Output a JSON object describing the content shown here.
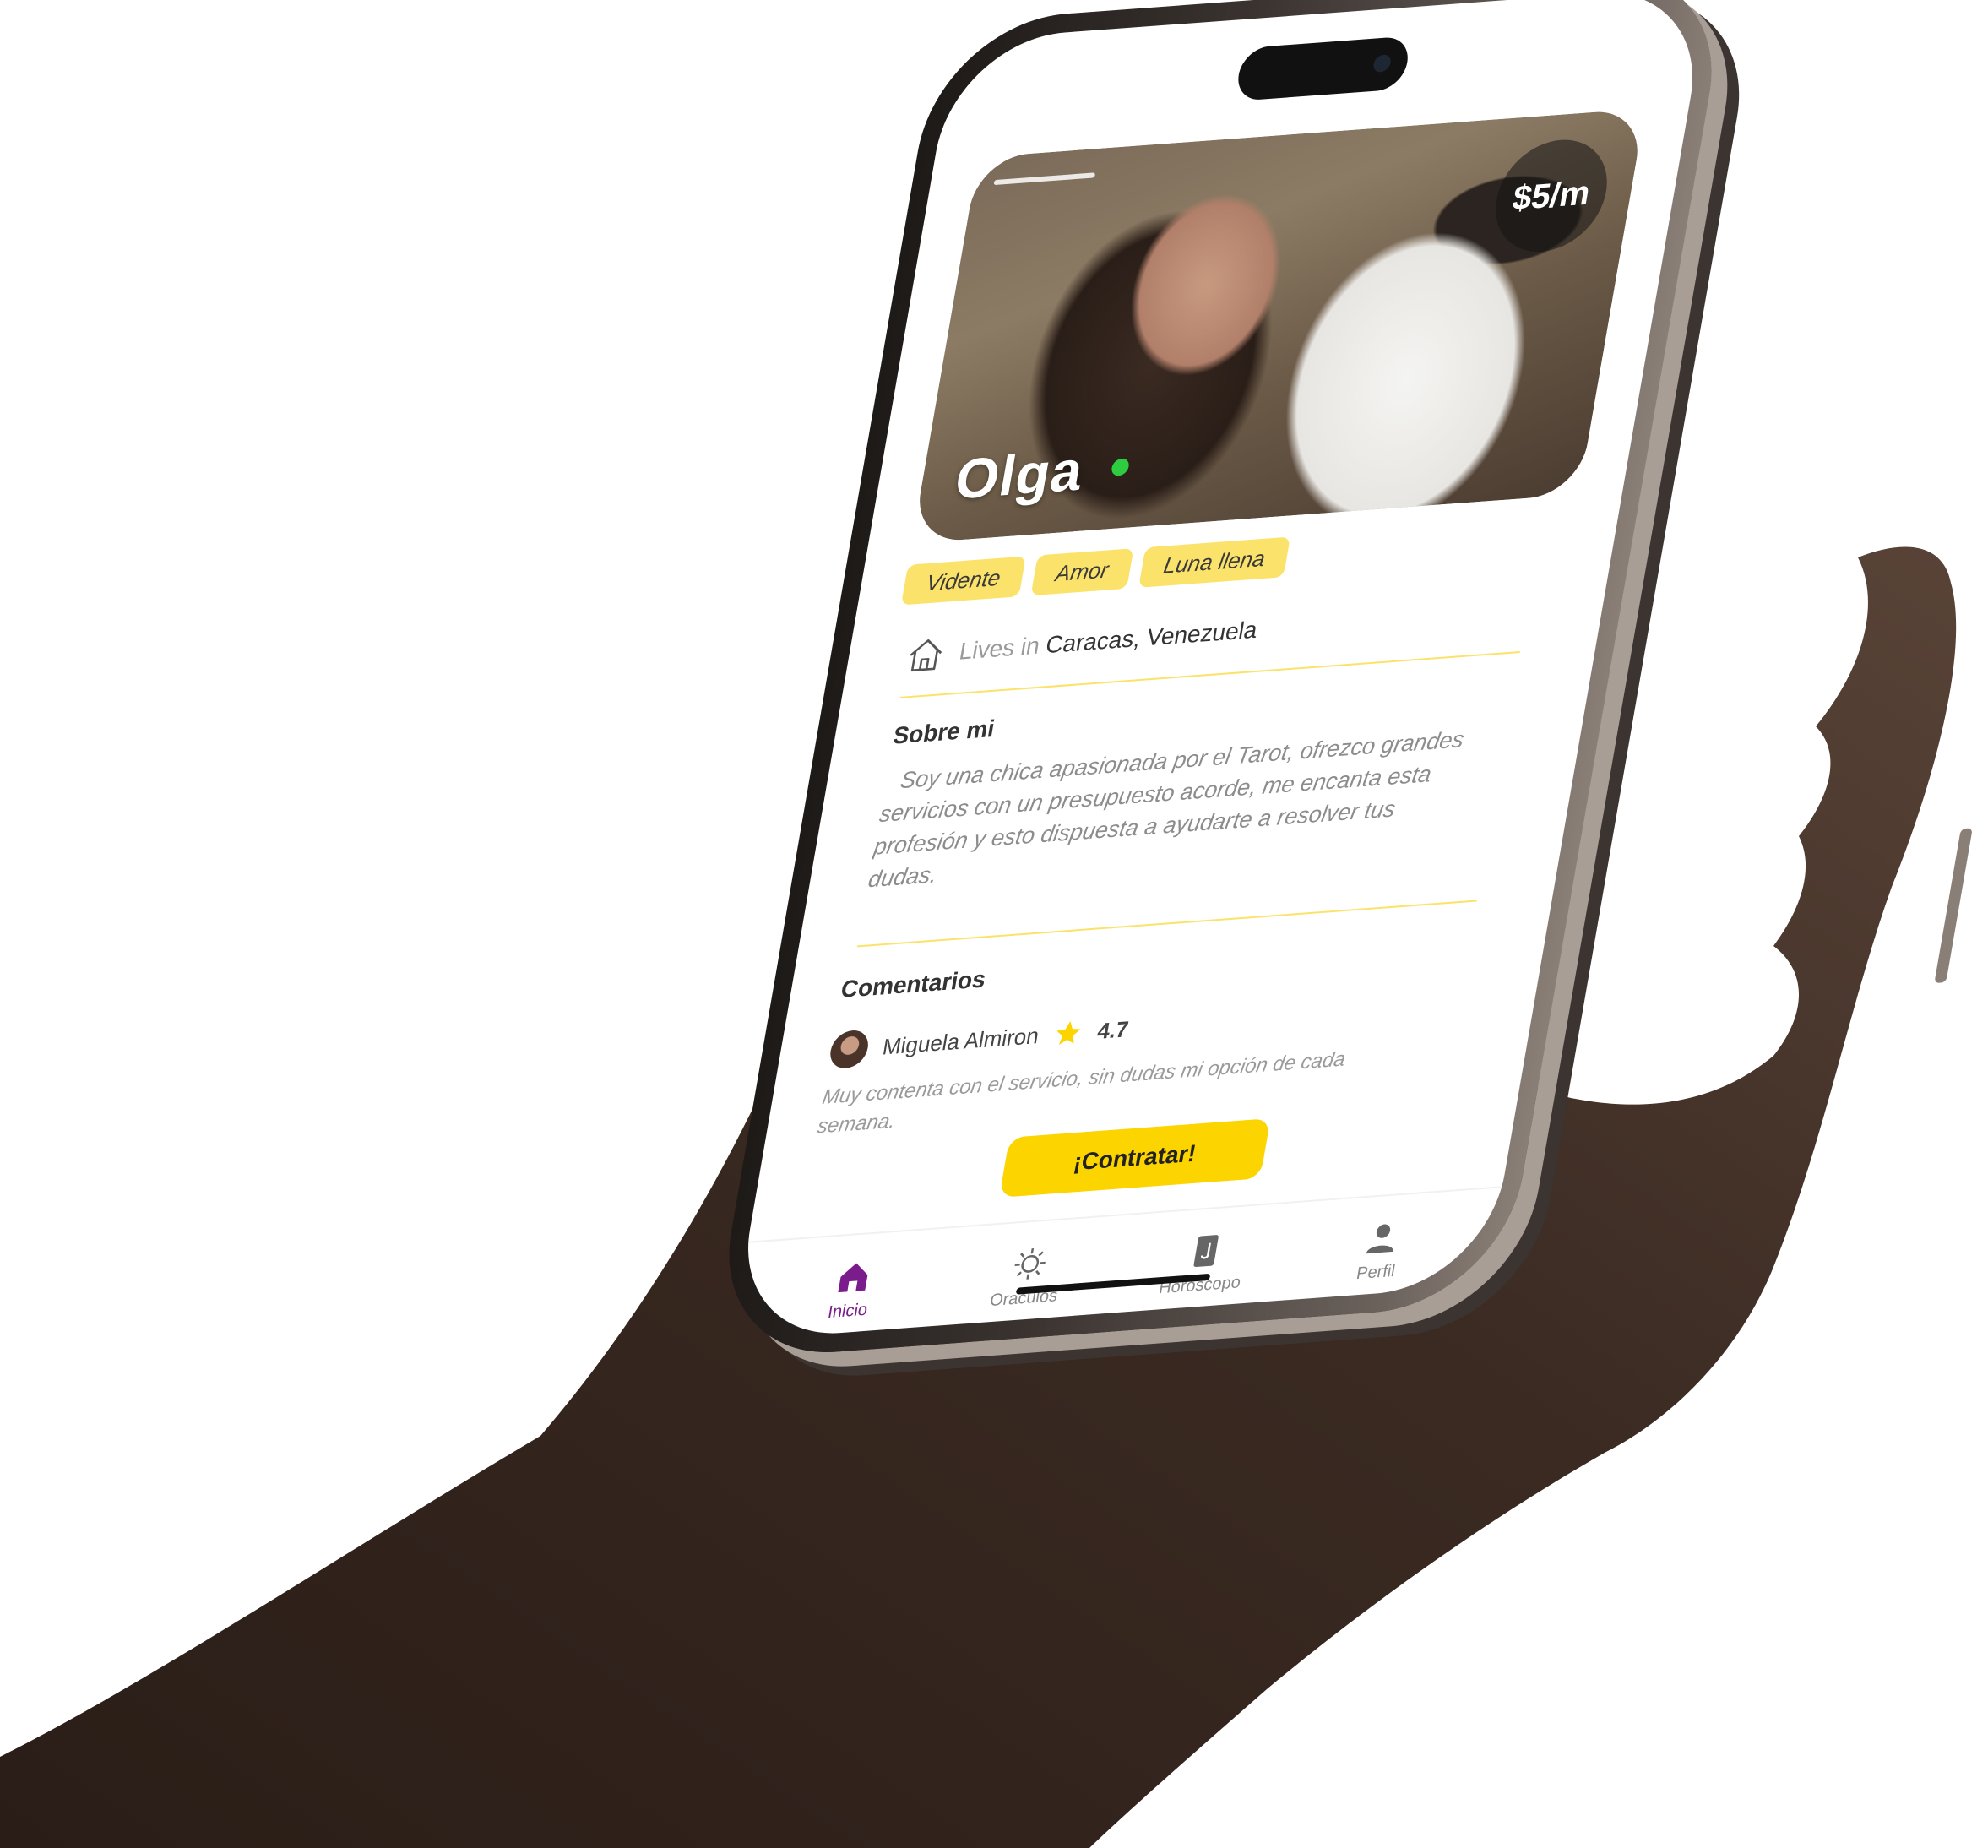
{
  "profile": {
    "name": "Olga",
    "price": "$5/m",
    "online": true,
    "tags": [
      "Vidente",
      "Amor",
      "Luna llena"
    ],
    "lives_prefix": "Lives in",
    "location": "Caracas, Venezuela"
  },
  "about": {
    "title": "Sobre mi",
    "text": "Soy una chica apasionada por el Tarot, ofrezco grandes servicios con un presupuesto acorde, me encanta esta profesión y esto dispuesta a ayudarte a resolver tus dudas."
  },
  "comments": {
    "title": "Comentarios",
    "items": [
      {
        "author": "Miguela Almiron",
        "rating": "4.7",
        "text": "Muy contenta con el servicio, sin dudas mi opción de cada semana."
      }
    ]
  },
  "cta": {
    "label": "¡Contratar!"
  },
  "tabs": [
    {
      "label": "Inicio",
      "icon": "home-icon",
      "active": true
    },
    {
      "label": "Oraculos",
      "icon": "sun-icon",
      "active": false
    },
    {
      "label": "Horoscopo",
      "icon": "card-icon",
      "active": false
    },
    {
      "label": "Perfil",
      "icon": "user-icon",
      "active": false
    }
  ],
  "colors": {
    "accent_yellow": "#fcd400",
    "tag_yellow": "#fbe36b",
    "active_tab": "#7a1c8c",
    "online_green": "#2ecc40"
  }
}
